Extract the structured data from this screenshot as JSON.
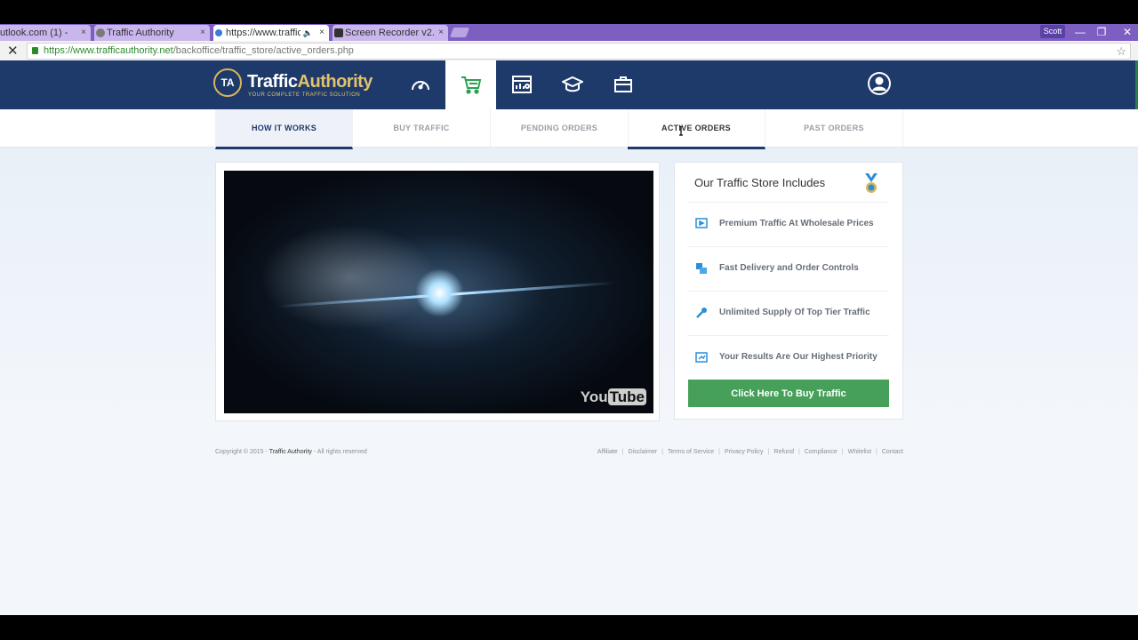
{
  "browser": {
    "tabs": [
      {
        "label": "utlook.com (1) - sn",
        "close": "×"
      },
      {
        "label": "Traffic Authority",
        "close": "×"
      },
      {
        "label": "https://www.traffic",
        "close": "×"
      },
      {
        "label": "Screen Recorder v2.0",
        "close": "×"
      }
    ],
    "profile": "Scott",
    "window_controls": {
      "minimize": "—",
      "restore": "❐",
      "close": "✕"
    },
    "url_host": "https://www.trafficauthority.net",
    "url_path": "/backoffice/traffic_store/active_orders.php"
  },
  "logo": {
    "badge": "TA",
    "name_part1": "Traffic",
    "name_part2": "Authority",
    "tagline": "YOUR COMPLETE TRAFFIC SOLUTION"
  },
  "nav_icons": [
    "speedometer-icon",
    "cart-icon",
    "stats-icon",
    "graduation-cap-icon",
    "briefcase-icon"
  ],
  "subnav": [
    {
      "label": "HOW IT WORKS"
    },
    {
      "label": "BUY TRAFFIC"
    },
    {
      "label": "PENDING ORDERS"
    },
    {
      "label": "ACTIVE ORDERS"
    },
    {
      "label": "PAST ORDERS"
    }
  ],
  "video": {
    "watermark_1": "You",
    "watermark_2": "Tube"
  },
  "panel": {
    "title": "Our Traffic Store Includes",
    "features": [
      {
        "text": "Premium Traffic At Wholesale Prices",
        "icon": "play-screen-icon"
      },
      {
        "text": "Fast Delivery and Order Controls",
        "icon": "controls-icon"
      },
      {
        "text": "Unlimited Supply Of Top Tier Traffic",
        "icon": "wrench-icon"
      },
      {
        "text": "Your Results Are Our Highest Priority",
        "icon": "results-icon"
      }
    ],
    "button": "Click Here To Buy Traffic"
  },
  "footer": {
    "copyright_prefix": "Copyright © 2015 - ",
    "brand": "Traffic Authority",
    "copyright_suffix": " - All rights reserved",
    "links": [
      "Affiliate",
      "Disclaimer",
      "Terms of Service",
      "Privacy Policy",
      "Refund",
      "Compliance",
      "Whitelist",
      "Contact"
    ],
    "separator": "|"
  },
  "colors": {
    "navbar": "#1d3a6b",
    "accent_gold": "#e3c26b",
    "button_green": "#46a05a",
    "icon_blue": "#2a8fd6"
  }
}
